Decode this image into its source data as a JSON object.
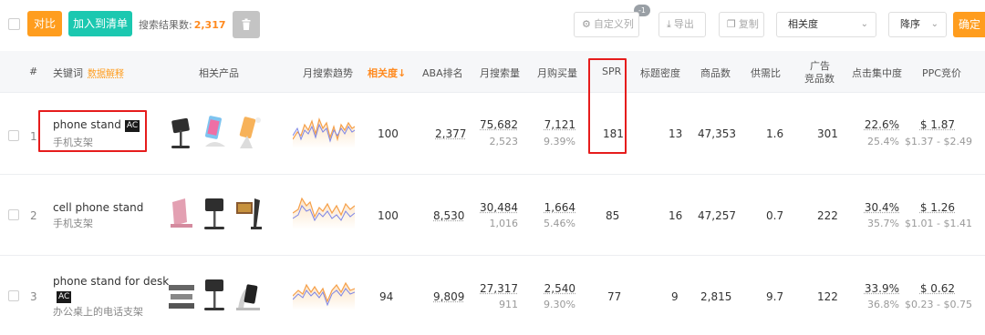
{
  "toolbar": {
    "compare_label": "对比",
    "add_list_label": "加入到清单",
    "result_prefix": "搜索结果数:",
    "result_count": "2,317",
    "custom_cols_label": "自定义列",
    "custom_cols_badge": "-1",
    "export_label": "导出",
    "copy_label": "复制",
    "sort_field": "相关度",
    "sort_order": "降序",
    "confirm_label": "确定"
  },
  "header": {
    "index": "#",
    "keyword": "关键词",
    "data_help": "数据解释",
    "products": "相关产品",
    "trend": "月搜索趋势",
    "relevance": "相关度↓",
    "aba": "ABA排名",
    "monthly_search": "月搜索量",
    "monthly_purchase": "月购买量",
    "spr": "SPR",
    "title_density": "标题密度",
    "product_count": "商品数",
    "supply_demand": "供需比",
    "ad_competitors_1": "广告",
    "ad_competitors_2": "竞品数",
    "click_concentration": "点击集中度",
    "ppc": "PPC竞价"
  },
  "rows": [
    {
      "index": "1",
      "keyword": "phone stand",
      "ac": "AC",
      "keyword_cn": "手机支架",
      "relevance": "100",
      "aba": "2,377",
      "search": "75,682",
      "search_sub": "2,523",
      "purchase": "7,121",
      "purchase_rate": "9.39%",
      "spr": "181",
      "title_density": "13",
      "products": "47,353",
      "supply_demand": "1.6",
      "ad_competitors": "301",
      "click_top": "22.6%",
      "click_sub": "25.4%",
      "ppc": "$ 1.87",
      "ppc_range": "$1.37 - $2.49"
    },
    {
      "index": "2",
      "keyword": "cell phone stand",
      "ac": "",
      "keyword_cn": "手机支架",
      "relevance": "100",
      "aba": "8,530",
      "search": "30,484",
      "search_sub": "1,016",
      "purchase": "1,664",
      "purchase_rate": "5.46%",
      "spr": "85",
      "title_density": "16",
      "products": "47,257",
      "supply_demand": "0.7",
      "ad_competitors": "222",
      "click_top": "30.4%",
      "click_sub": "35.7%",
      "ppc": "$ 1.26",
      "ppc_range": "$1.01 - $1.41"
    },
    {
      "index": "3",
      "keyword": "phone stand for desk",
      "ac": "AC",
      "keyword_cn": "办公桌上的电话支架",
      "relevance": "94",
      "aba": "9,809",
      "search": "27,317",
      "search_sub": "911",
      "purchase": "2,540",
      "purchase_rate": "9.30%",
      "spr": "77",
      "title_density": "9",
      "products": "2,815",
      "supply_demand": "9.7",
      "ad_competitors": "122",
      "click_top": "33.9%",
      "click_sub": "36.8%",
      "ppc": "$ 0.62",
      "ppc_range": "$0.23 - $0.75"
    }
  ],
  "colors": {
    "accent": "#ff9d1e",
    "teal": "#1bc8b0",
    "highlight": "#e61c1c",
    "trend_line_a": "#f5a04a",
    "trend_line_b": "#7d86e6"
  },
  "icons": [
    "checkbox-icon",
    "trash-icon",
    "gear-icon",
    "download-icon",
    "copy-icon",
    "chevron-down-icon"
  ]
}
